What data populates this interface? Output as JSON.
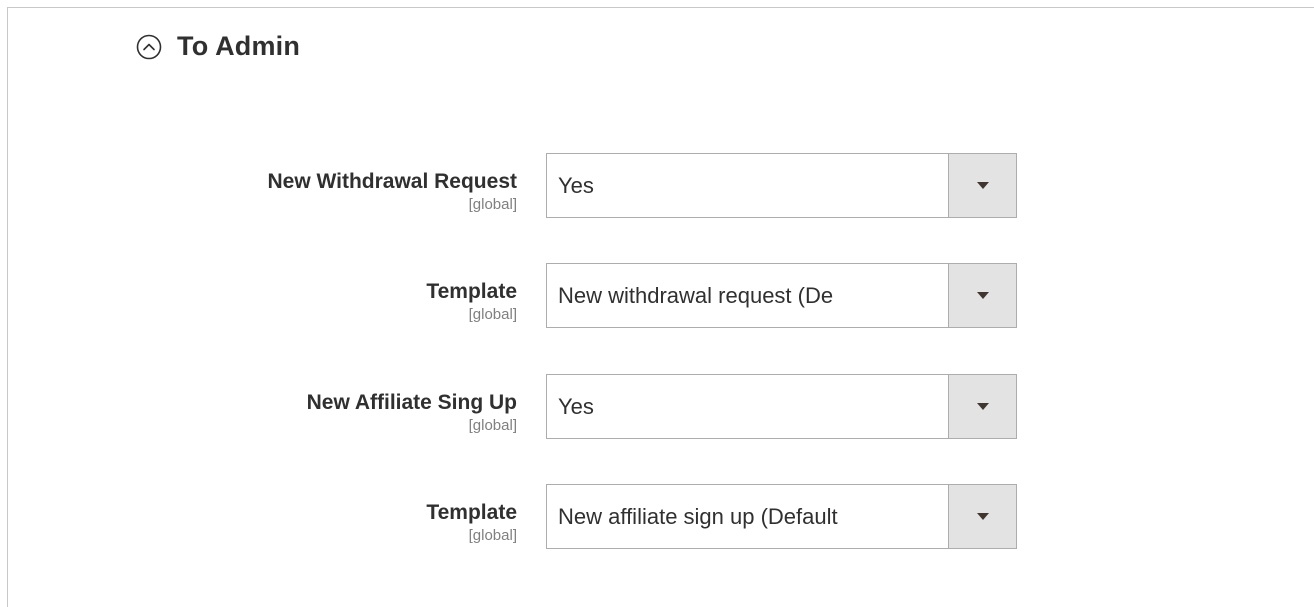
{
  "section": {
    "title": "To Admin",
    "icon": "chevron-up-circle-icon"
  },
  "fields": [
    {
      "label": "New Withdrawal Request",
      "scope": "[global]",
      "value": "Yes"
    },
    {
      "label": "Template",
      "scope": "[global]",
      "value": "New withdrawal request (De"
    },
    {
      "label": "New Affiliate Sing Up",
      "scope": "[global]",
      "value": "Yes"
    },
    {
      "label": "Template",
      "scope": "[global]",
      "value": "New affiliate sign up (Default"
    }
  ],
  "colors": {
    "text": "#303030",
    "scope_text": "#808080",
    "select_border": "#adadad",
    "arrow_bg": "#e3e3e3",
    "arrow": "#41362f"
  }
}
